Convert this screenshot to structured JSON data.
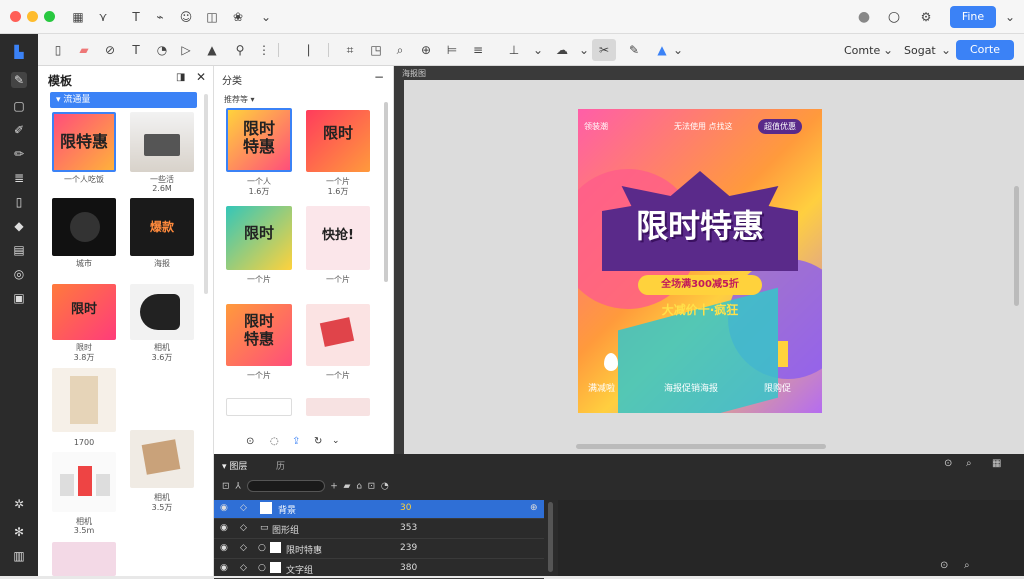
{
  "toolbar_right": {
    "font_label": "Comte",
    "style_label": "Sogat",
    "action_label": "Corte",
    "title_button": "Fine"
  },
  "templates_panel": {
    "title": "模板",
    "active_tab": "流通量",
    "items": [
      {
        "caption": "一个人吃饭",
        "sub": ""
      },
      {
        "caption": "一些活",
        "sub": "2.6M"
      },
      {
        "caption": "城市",
        "sub": ""
      },
      {
        "caption": "海报",
        "sub": ""
      },
      {
        "caption": "限时",
        "sub": "3.8万"
      },
      {
        "caption": "相机",
        "sub": "3.6万"
      },
      {
        "caption": "",
        "sub": "1700"
      },
      {
        "caption": "相机",
        "sub": "3.5万"
      },
      {
        "caption": "相机",
        "sub": "3.5m"
      }
    ]
  },
  "elements_panel": {
    "title": "分类",
    "filter_label": "推荐等",
    "items": [
      {
        "caption": "1.6万",
        "line": "一个人"
      },
      {
        "caption": "1.6万",
        "line": "一个片"
      },
      {
        "caption": "一个片",
        "line": ""
      },
      {
        "caption": "一个片",
        "line": ""
      },
      {
        "caption": "一个片",
        "line": ""
      },
      {
        "caption": "一个片",
        "line": ""
      }
    ]
  },
  "canvas": {
    "ruler_label": "海报图",
    "poster": {
      "headline": "限时特惠",
      "brand": "领装潮",
      "tagline": "无法使用 点找这",
      "badge": "超值优惠",
      "sub_banner": "全场满300减5折",
      "sub_line": "大减价十·疯狂",
      "bottom_left": "满减啦",
      "bottom_center": "海报促销海报",
      "bottom_right": "限购促"
    }
  },
  "layers_panel": {
    "tab1": "图层",
    "tab2": "历",
    "rows": [
      {
        "name": "背景",
        "value": "30",
        "selected": true
      },
      {
        "name": "图形组",
        "value": "353",
        "selected": false
      },
      {
        "name": "限时特惠",
        "value": "239",
        "selected": false
      },
      {
        "name": "文字组",
        "value": "380",
        "selected": false
      }
    ]
  },
  "colors": {
    "accent": "#3b82f6",
    "dark": "#2b2b2b"
  }
}
